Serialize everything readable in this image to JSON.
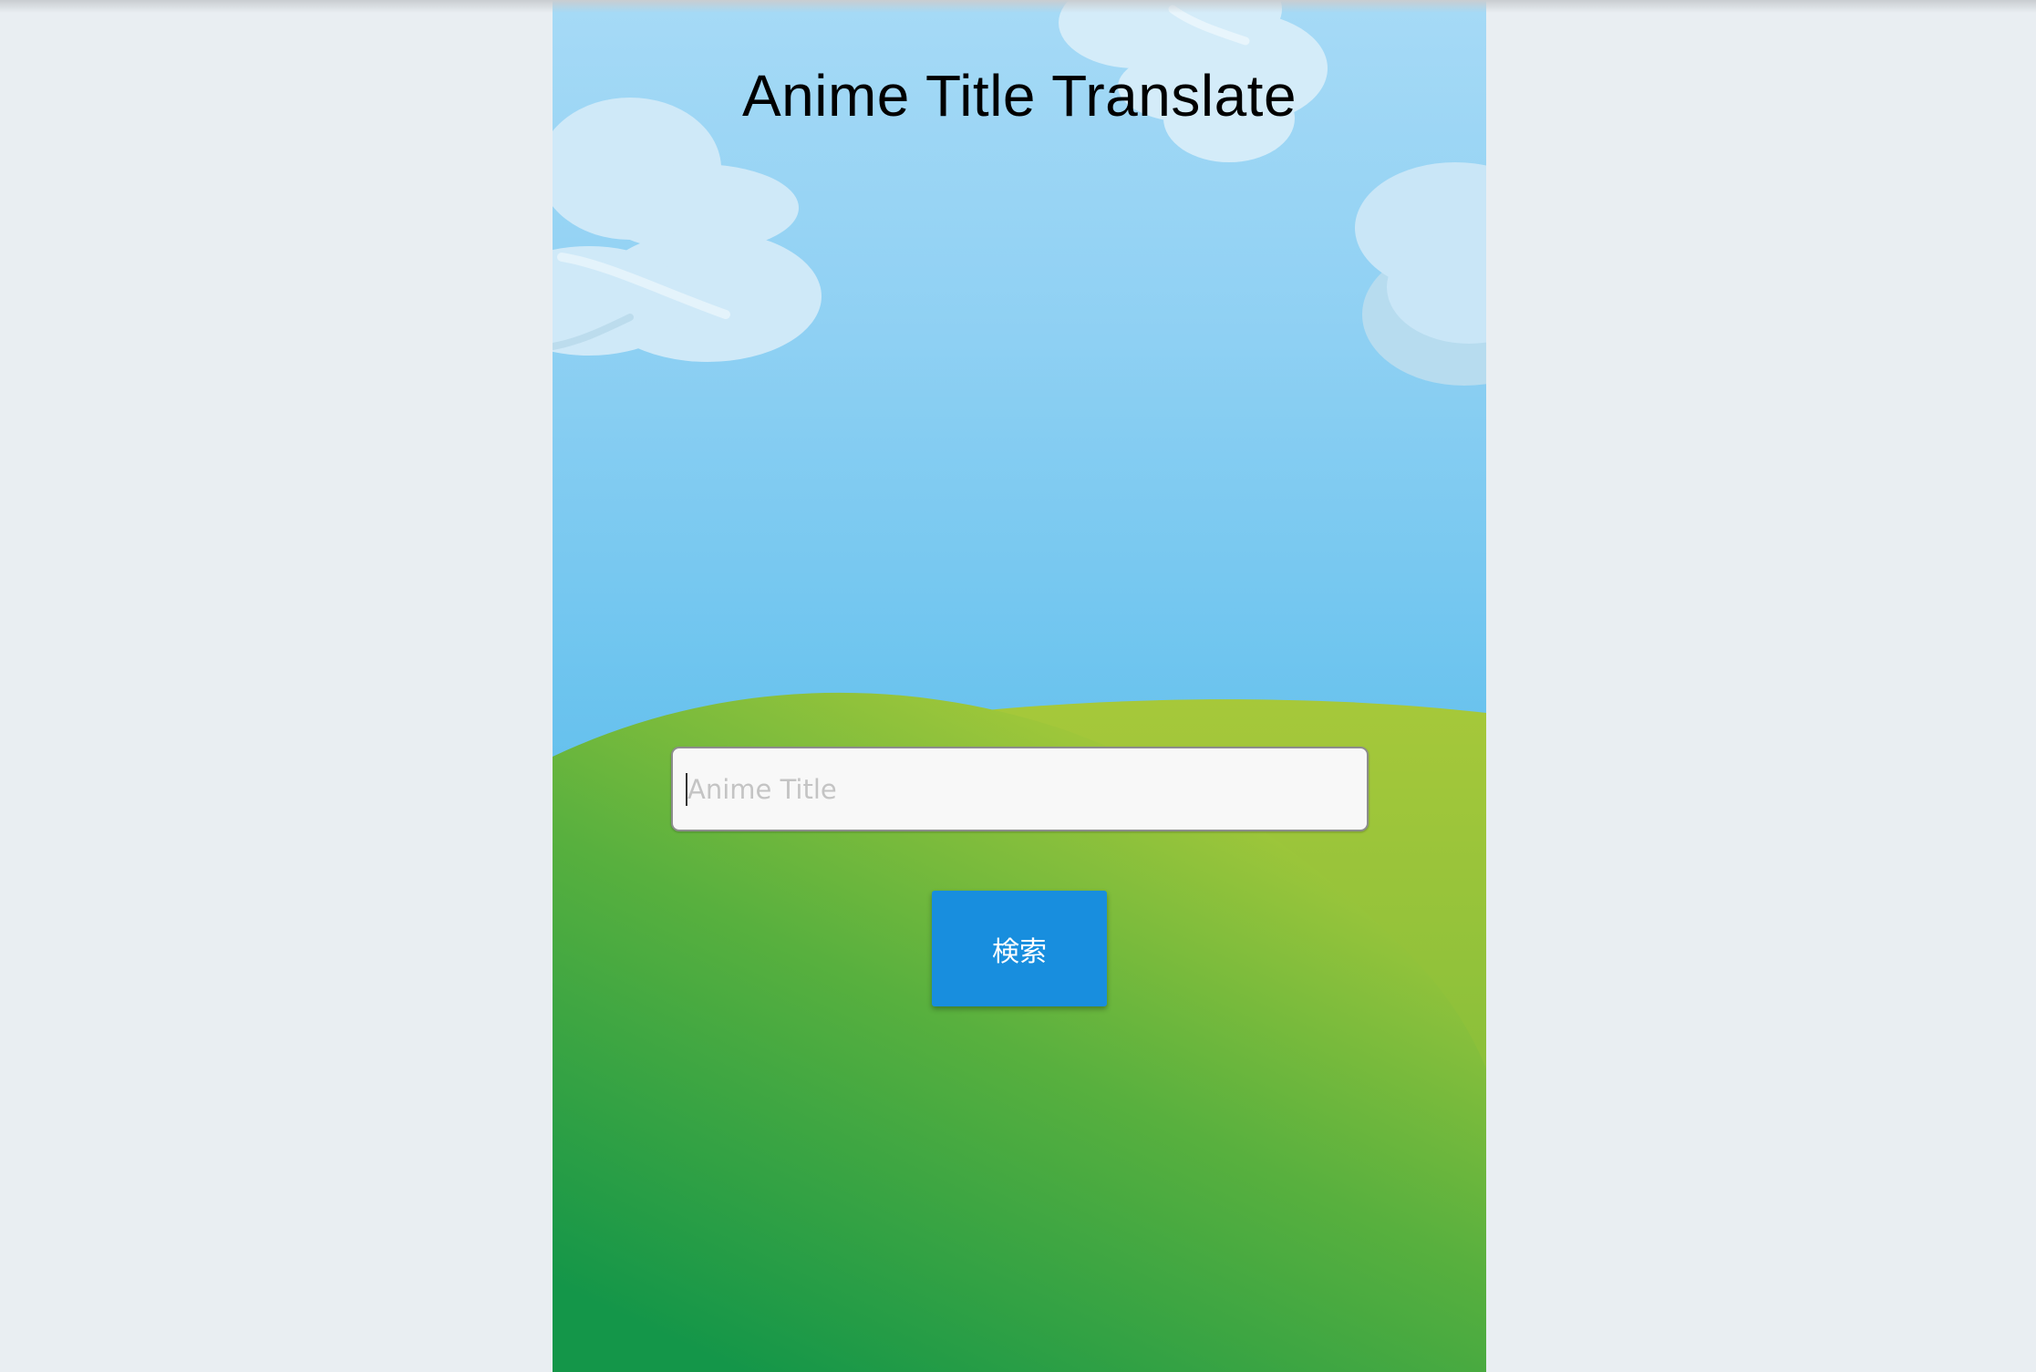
{
  "app": {
    "title": "Anime Title Translate"
  },
  "search": {
    "placeholder": "Anime Title",
    "value": "",
    "button_label": "検索"
  },
  "colors": {
    "page_background": "#e9eef2",
    "sky_top": "#a6daf6",
    "sky_bottom": "#45b0e5",
    "hill_light": "#a3c83a",
    "hill_dark": "#169a4a",
    "button": "#188ede",
    "button_text": "#ffffff"
  }
}
